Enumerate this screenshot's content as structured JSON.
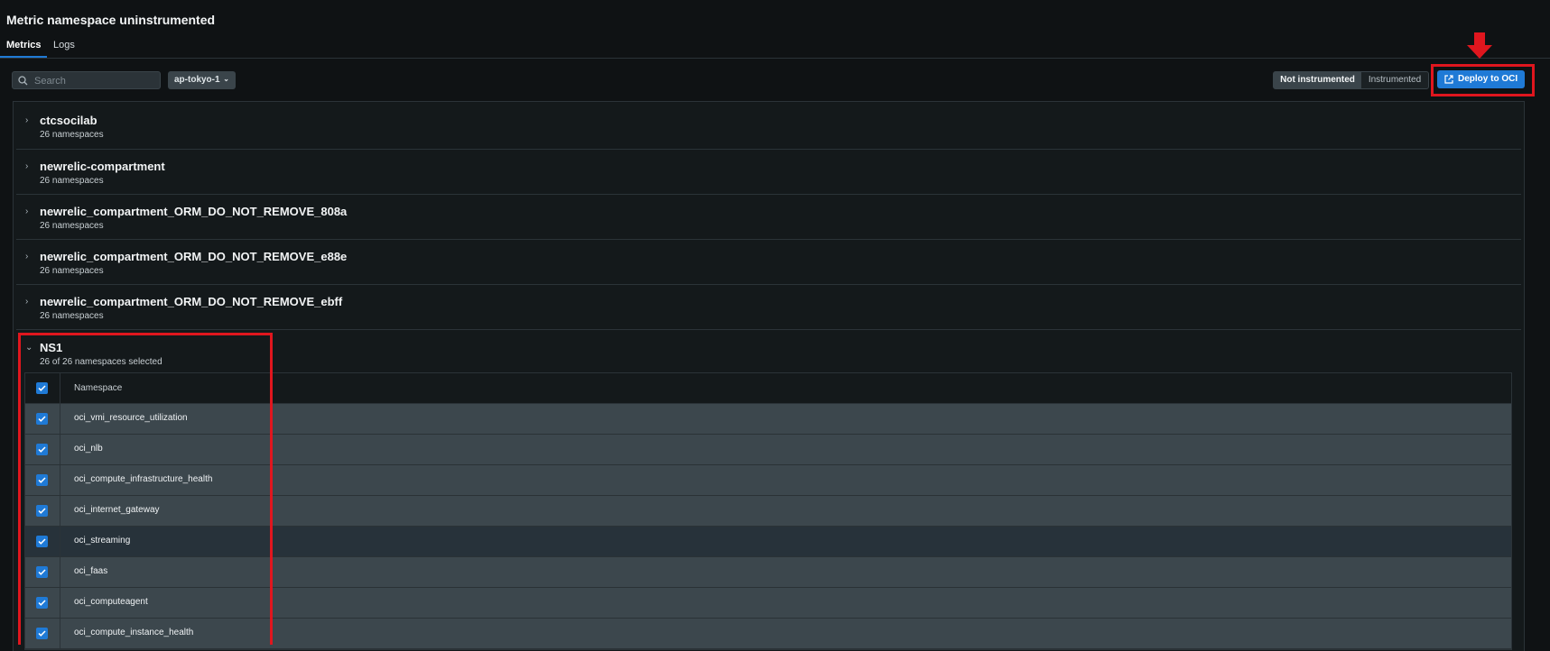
{
  "page": {
    "title": "Metric namespace uninstrumented"
  },
  "tabs": [
    {
      "label": "Metrics"
    },
    {
      "label": "Logs"
    }
  ],
  "toolbar": {
    "search_placeholder": "Search",
    "region": "ap-tokyo-1",
    "toggle": {
      "options": [
        "Not instrumented",
        "Instrumented"
      ],
      "selected": "Not instrumented"
    },
    "deploy_label": "Deploy to OCI"
  },
  "groups": [
    {
      "name": "ctcsocilab",
      "subtitle": "26 namespaces",
      "expanded": false
    },
    {
      "name": "newrelic-compartment",
      "subtitle": "26 namespaces",
      "expanded": false
    },
    {
      "name": "newrelic_compartment_ORM_DO_NOT_REMOVE_808a",
      "subtitle": "26 namespaces",
      "expanded": false
    },
    {
      "name": "newrelic_compartment_ORM_DO_NOT_REMOVE_e88e",
      "subtitle": "26 namespaces",
      "expanded": false
    },
    {
      "name": "newrelic_compartment_ORM_DO_NOT_REMOVE_ebff",
      "subtitle": "26 namespaces",
      "expanded": false
    },
    {
      "name": "NS1",
      "subtitle": "26 of 26 namespaces selected",
      "expanded": true
    }
  ],
  "table": {
    "header": "Namespace",
    "rows": [
      "oci_vmi_resource_utilization",
      "oci_nlb",
      "oci_compute_infrastructure_health",
      "oci_internet_gateway",
      "oci_streaming",
      "oci_faas",
      "oci_computeagent",
      "oci_compute_instance_health"
    ]
  },
  "colors": {
    "accent": "#1f7ad6",
    "highlight": "#e0161e",
    "background": "#0f1214"
  }
}
